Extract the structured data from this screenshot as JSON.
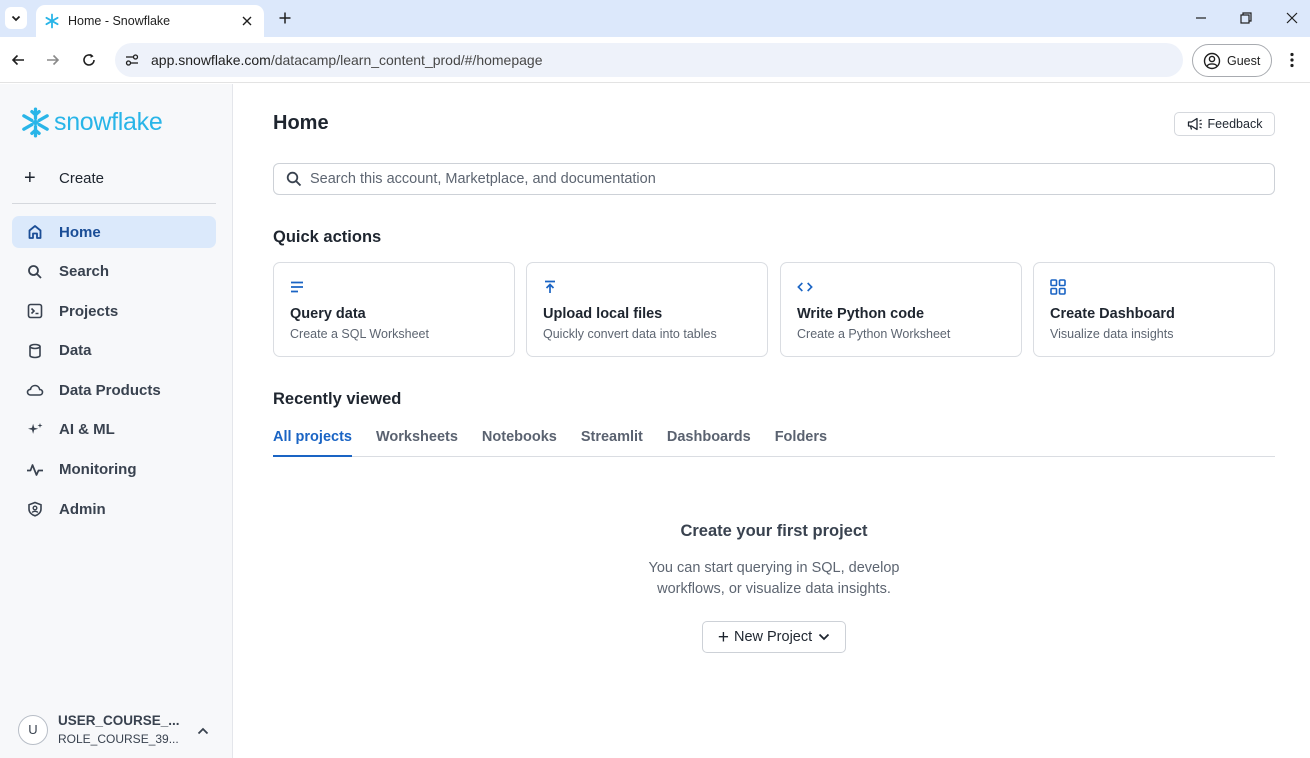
{
  "browser": {
    "tab_title": "Home - Snowflake",
    "url_host": "app.snowflake.com",
    "url_path": "/datacamp/learn_content_prod/#/homepage",
    "profile_label": "Guest"
  },
  "sidebar": {
    "logo_text": "snowflake",
    "create_label": "Create",
    "items": [
      {
        "label": "Home",
        "icon": "home-icon"
      },
      {
        "label": "Search",
        "icon": "search-icon"
      },
      {
        "label": "Projects",
        "icon": "terminal-icon"
      },
      {
        "label": "Data",
        "icon": "database-icon"
      },
      {
        "label": "Data Products",
        "icon": "cloud-icon"
      },
      {
        "label": "AI & ML",
        "icon": "sparkle-icon"
      },
      {
        "label": "Monitoring",
        "icon": "activity-icon"
      },
      {
        "label": "Admin",
        "icon": "shield-icon"
      }
    ],
    "user": {
      "initial": "U",
      "name": "USER_COURSE_...",
      "role": "ROLE_COURSE_39..."
    }
  },
  "main": {
    "title": "Home",
    "feedback_label": "Feedback",
    "search_placeholder": "Search this account, Marketplace, and documentation",
    "quick_actions_title": "Quick actions",
    "quick_actions": [
      {
        "title": "Query data",
        "subtitle": "Create a SQL Worksheet",
        "icon": "lines-icon"
      },
      {
        "title": "Upload local files",
        "subtitle": "Quickly convert data into tables",
        "icon": "upload-icon"
      },
      {
        "title": "Write Python code",
        "subtitle": "Create a Python Worksheet",
        "icon": "code-icon"
      },
      {
        "title": "Create Dashboard",
        "subtitle": "Visualize data insights",
        "icon": "grid-icon"
      }
    ],
    "recent_title": "Recently viewed",
    "tabs": [
      "All projects",
      "Worksheets",
      "Notebooks",
      "Streamlit",
      "Dashboards",
      "Folders"
    ],
    "active_tab": "All projects",
    "empty_title": "Create your first project",
    "empty_line1": "You can start querying in SQL, develop",
    "empty_line2": "workflows, or visualize data insights.",
    "new_project_label": "New Project"
  },
  "colors": {
    "accent": "#1a64c4",
    "brand": "#29b5e8",
    "active_nav_bg": "#dbe9fb",
    "tabbar_bg": "#dce8fb"
  }
}
